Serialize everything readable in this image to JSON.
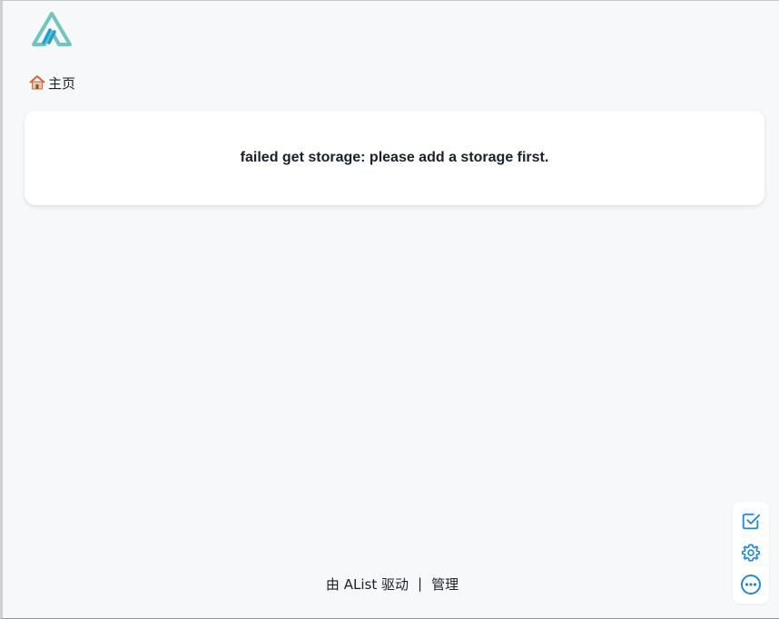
{
  "logo": {
    "icon": "alist-logo-icon",
    "colors": [
      "#70c6be",
      "#1ba0d8"
    ]
  },
  "breadcrumb": {
    "icon": "home-icon",
    "label": "主页"
  },
  "message": "failed get storage: please add a storage first.",
  "footer": {
    "prefix": "由",
    "brand": "AList",
    "suffix": "驱动",
    "separator": "|",
    "manage_label": "管理"
  },
  "side_tools": [
    {
      "icon": "checkbox-icon"
    },
    {
      "icon": "settings-gear-icon"
    },
    {
      "icon": "more-options-icon"
    }
  ],
  "colors": {
    "accent": "#1e88e5",
    "background": "#f6f8fa",
    "card": "#ffffff"
  }
}
